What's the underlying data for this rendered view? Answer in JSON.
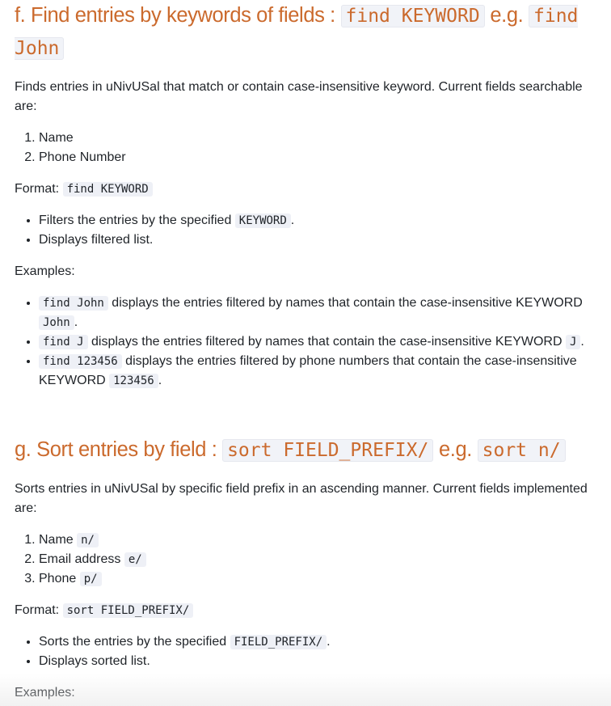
{
  "sections": [
    {
      "heading_text": "f. Find entries by keywords of fields : ",
      "heading_code1": "find KEYWORD",
      "heading_mid": " e.g. ",
      "heading_code2": "find John",
      "description": "Finds entries in uNivUSal that match or contain case-insensitive keyword. Current fields searchable are:",
      "fields": [
        "Name",
        "Phone Number"
      ],
      "format_label": "Format: ",
      "format_code": "find KEYWORD",
      "bullets": [
        {
          "before": "Filters the entries by the specified ",
          "code": "KEYWORD",
          "after": "."
        },
        {
          "before": "Displays filtered list.",
          "code": "",
          "after": ""
        }
      ],
      "examples_label": "Examples:",
      "examples": [
        {
          "code": "find John",
          "text": " displays the entries filtered by names that contain the case-insensitive KEYWORD ",
          "code2": "John",
          "after": "."
        },
        {
          "code": "find J",
          "text": " displays the entries filtered by names that contain the case-insensitive KEYWORD ",
          "code2": "J",
          "after": "."
        },
        {
          "code": "find 123456",
          "text": " displays the entries filtered by phone numbers that contain the case-insensitive KEYWORD ",
          "code2": "123456",
          "after": "."
        }
      ]
    },
    {
      "heading_text": "g. Sort entries by field : ",
      "heading_code1": "sort FIELD_PREFIX/",
      "heading_mid": " e.g. ",
      "heading_code2": "sort n/",
      "description": "Sorts entries in uNivUSal by specific field prefix in an ascending manner. Current fields implemented are:",
      "fields": [
        {
          "label": "Name ",
          "code": "n/"
        },
        {
          "label": "Email address ",
          "code": "e/"
        },
        {
          "label": "Phone ",
          "code": "p/"
        }
      ],
      "format_label": "Format: ",
      "format_code": "sort FIELD_PREFIX/",
      "bullets": [
        {
          "before": "Sorts the entries by the specified ",
          "code": "FIELD_PREFIX/",
          "after": "."
        },
        {
          "before": "Displays sorted list.",
          "code": "",
          "after": ""
        }
      ],
      "examples_label": "Examples:"
    }
  ]
}
